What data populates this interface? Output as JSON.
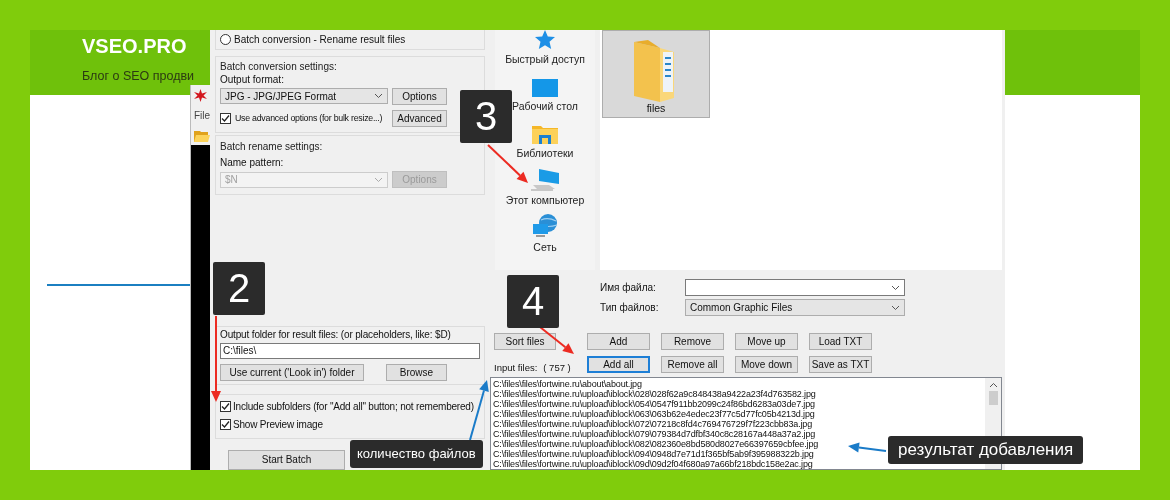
{
  "blog": {
    "logo": "VSEO.PRO",
    "tagline": "Блог о SEO продви"
  },
  "viewer": {
    "menu": "File"
  },
  "dialog": {
    "mode_radio": {
      "label": "Batch conversion - Rename result files",
      "selected": false
    },
    "conversion": {
      "title": "Batch conversion settings:",
      "format_label": "Output format:",
      "format": "JPG - JPG/JPEG Format",
      "options_button": "Options",
      "advanced": {
        "label": "Use advanced options (for bulk resize...)",
        "checked": true
      },
      "advanced_button": "Advanced"
    },
    "rename": {
      "title": "Batch rename settings:",
      "pattern_label": "Name pattern:",
      "pattern": "$N",
      "options_button": "Options",
      "disabled": true
    },
    "output": {
      "label": "Output folder for result files: (or placeholders, like: $D)",
      "value": "C:\\files\\",
      "current_button": "Use current ('Look in') folder",
      "browse_button": "Browse"
    },
    "checkboxes": [
      {
        "label": "Include subfolders (for \"Add all\" button; not remembered)",
        "checked": true
      },
      {
        "label": "Show Preview image",
        "checked": true
      }
    ],
    "start_button": "Start Batch",
    "places": [
      {
        "kind": "star",
        "label": "Быстрый доступ"
      },
      {
        "kind": "desktop",
        "label": "Рабочий стол"
      },
      {
        "kind": "library",
        "label": "Библиотеки"
      },
      {
        "kind": "computer",
        "label": "Этот компьютер"
      },
      {
        "kind": "network",
        "label": "Сеть"
      }
    ],
    "files": [
      {
        "name": "files",
        "selected": true
      }
    ],
    "filename": {
      "label": "Имя файла:"
    },
    "filetype": {
      "label": "Тип файлов:",
      "value": "Common Graphic Files"
    },
    "buttons_row1": [
      {
        "label": "Sort files",
        "focused": false
      },
      {
        "label": "Add",
        "focused": false
      },
      {
        "label": "Remove",
        "focused": false
      },
      {
        "label": "Move up",
        "focused": false
      },
      {
        "label": "Load TXT",
        "focused": false
      }
    ],
    "input_label": "Input files:",
    "input_count": "( 757 )",
    "buttons_row2": [
      {
        "label": "Add all",
        "focused": true
      },
      {
        "label": "Remove all",
        "focused": false
      },
      {
        "label": "Move down",
        "focused": false
      },
      {
        "label": "Save as TXT",
        "focused": false
      }
    ],
    "input_files": [
      "C:\\files\\files\\fortwine.ru\\about\\about.jpg",
      "C:\\files\\files\\fortwine.ru\\upload\\iblock\\028\\028f62a9c848438a9422a23f4d763582.jpg",
      "C:\\files\\files\\fortwine.ru\\upload\\iblock\\054\\0547f911bb2099c24f86bd6283a03de7.jpg",
      "C:\\files\\files\\fortwine.ru\\upload\\iblock\\063\\063b62e4edec23f77c5d77fc05b4213d.jpg",
      "C:\\files\\files\\fortwine.ru\\upload\\iblock\\072\\07218c8fd4c769476729f7f223cbb83a.jpg",
      "C:\\files\\files\\fortwine.ru\\upload\\iblock\\079\\079384d7dfbf340c8c28167a448a37a2.jpg",
      "C:\\files\\files\\fortwine.ru\\upload\\iblock\\082\\082360e8bd580d8027e66397659cbfee.jpg",
      "C:\\files\\files\\fortwine.ru\\upload\\iblock\\094\\0948d7e71d1f365bf5ab9f395988322b.jpg",
      "C:\\files\\files\\fortwine.ru\\upload\\iblock\\09d\\09d2f04f680a97a66bf218bdc158e2ac.jpg"
    ]
  },
  "markers": [
    {
      "text": "3"
    },
    {
      "text": "4"
    },
    {
      "text": "2"
    }
  ],
  "callouts": [
    {
      "text": "количество файлов"
    },
    {
      "text": "результат добавления"
    }
  ]
}
